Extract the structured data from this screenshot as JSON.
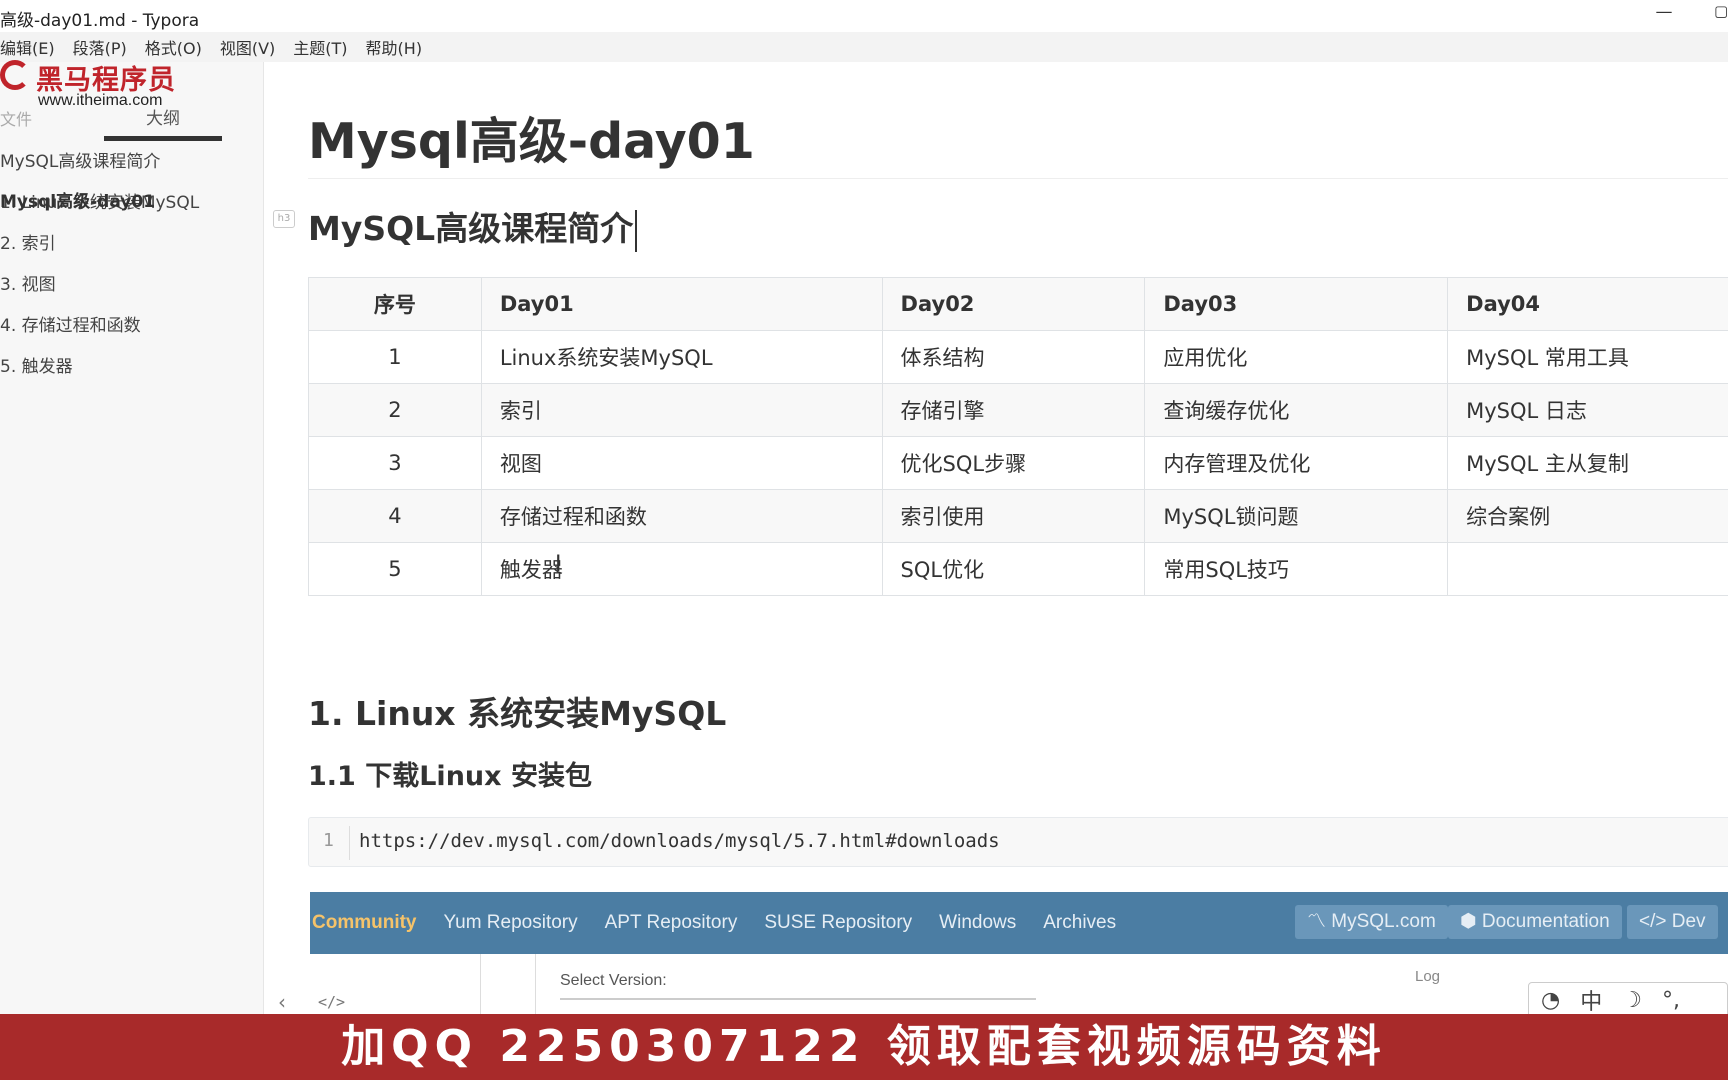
{
  "window": {
    "title": "高级-day01.md - Typora",
    "minimize_glyph": "—",
    "maximize_glyph": "▢"
  },
  "menu": [
    "编辑(E)",
    "段落(P)",
    "格式(O)",
    "视图(V)",
    "主题(T)",
    "帮助(H)"
  ],
  "watermark": {
    "brand": "黑马程序员",
    "url": "www.itheima.com"
  },
  "sidebar": {
    "tab_files": "文件",
    "tab_outline": "大纲",
    "outline": [
      {
        "label": "Mysql高级-day01",
        "level": 1
      },
      {
        "label": "MySQL高级课程简介",
        "level": 2
      },
      {
        "label": "1. Linux 系统安装MySQL",
        "level": 2
      },
      {
        "label": "2. 索引",
        "level": 2
      },
      {
        "label": "3. 视图",
        "level": 2
      },
      {
        "label": "4. 存储过程和函数",
        "level": 2
      },
      {
        "label": "5. 触发器",
        "level": 2
      }
    ]
  },
  "doc": {
    "h1": "Mysql高级-day01",
    "h3_marker": "h3",
    "section_intro": "MySQL高级课程简介",
    "table": {
      "headers": [
        "序号",
        "Day01",
        "Day02",
        "Day03",
        "Day04"
      ],
      "rows": [
        [
          "1",
          "Linux系统安装MySQL",
          "体系结构",
          "应用优化",
          "MySQL 常用工具"
        ],
        [
          "2",
          "索引",
          "存储引擎",
          "查询缓存优化",
          "MySQL 日志"
        ],
        [
          "3",
          "视图",
          "优化SQL步骤",
          "内存管理及优化",
          "MySQL 主从复制"
        ],
        [
          "4",
          "存储过程和函数",
          "索引使用",
          "MySQL锁问题",
          "综合案例"
        ],
        [
          "5",
          "触发器",
          "SQL优化",
          "常用SQL技巧",
          ""
        ]
      ]
    },
    "section_linux": "1. Linux 系统安装MySQL",
    "subsection_download": "1.1 下载Linux 安装包",
    "code": {
      "line_no": "1",
      "text": "https://dev.mysql.com/downloads/mysql/5.7.html#downloads"
    },
    "site_screenshot": {
      "nav_active": "Community",
      "nav_links": [
        "Yum Repository",
        "APT Repository",
        "SUSE Repository",
        "Windows",
        "Archives"
      ],
      "pills": [
        "MySQL.com",
        "Documentation",
        "Dev"
      ],
      "select_version_label": "Select Version:",
      "login_text": "Log"
    }
  },
  "editor_footer": {
    "back_glyph": "‹",
    "source_glyph": "</>"
  },
  "ime": {
    "items": [
      "◔",
      "中",
      "☽",
      "°,"
    ]
  },
  "banner": {
    "text": "加QQ 2250307122  领取配套视频源码资料"
  },
  "colors": {
    "banner_bg": "#a82a2a",
    "mysql_nav": "#4b7da3",
    "mysql_active": "#f5c36a",
    "brand_red": "#c0242b"
  }
}
